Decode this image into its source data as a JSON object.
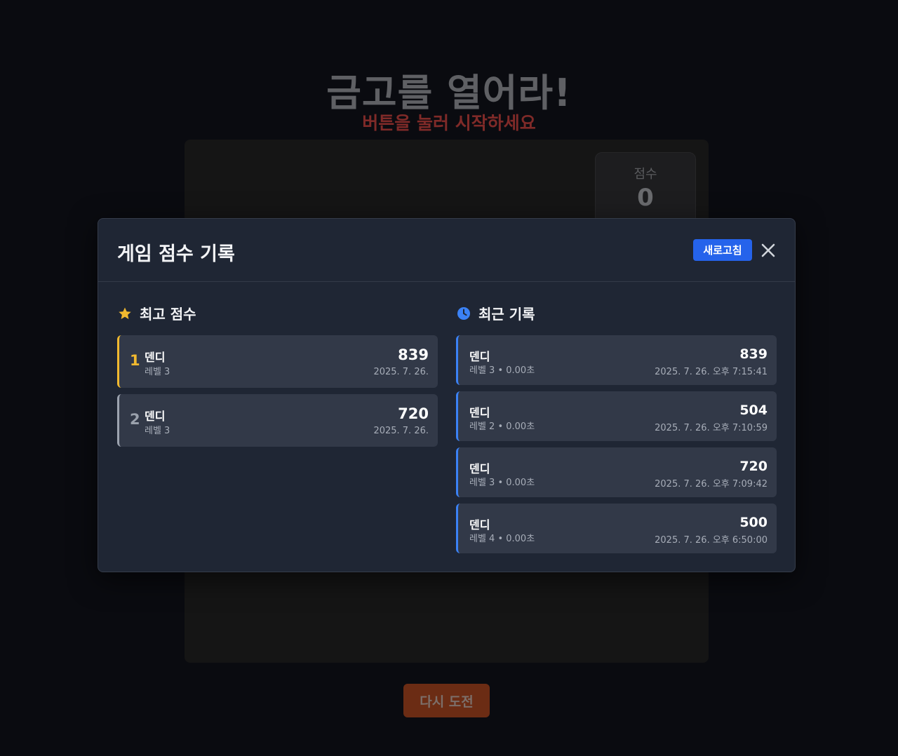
{
  "background": {
    "title": "금고를 열어라!",
    "subtitle": "버튼을 눌러 시작하세요",
    "score_label": "점수",
    "score_value": "0",
    "retry_label": "다시 도전"
  },
  "modal": {
    "title": "게임 점수 기록",
    "refresh_label": "새로고침",
    "close_icon": "close-icon",
    "best": {
      "title": "최고 점수",
      "icon": "star-icon",
      "items": [
        {
          "rank": "1",
          "name": "덴디",
          "level": "레벨 3",
          "score": "839",
          "date": "2025. 7. 26."
        },
        {
          "rank": "2",
          "name": "덴디",
          "level": "레벨 3",
          "score": "720",
          "date": "2025. 7. 26."
        }
      ]
    },
    "recent": {
      "title": "최근 기록",
      "icon": "clock-icon",
      "items": [
        {
          "name": "덴디",
          "meta": "레벨 3 • 0.00초",
          "score": "839",
          "date": "2025. 7. 26. 오후 7:15:41"
        },
        {
          "name": "덴디",
          "meta": "레벨 2 • 0.00초",
          "score": "504",
          "date": "2025. 7. 26. 오후 7:10:59"
        },
        {
          "name": "덴디",
          "meta": "레벨 3 • 0.00초",
          "score": "720",
          "date": "2025. 7. 26. 오후 7:09:42"
        },
        {
          "name": "덴디",
          "meta": "레벨 4 • 0.00초",
          "score": "500",
          "date": "2025. 7. 26. 오후 6:50:00"
        }
      ]
    }
  },
  "colors": {
    "accent_blue": "#2563eb",
    "gold": "#f1b92f",
    "recent_border": "#3b82f6"
  }
}
